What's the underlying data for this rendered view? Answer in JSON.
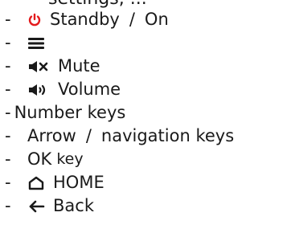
{
  "top_fragment": "settings, ...",
  "items": [
    {
      "bullet": "-",
      "icon": "power-icon",
      "label": "Standby",
      "sep": "/",
      "label2": "On"
    },
    {
      "bullet": "-",
      "icon": "menu-icon"
    },
    {
      "bullet": "-",
      "icon": "mute-icon",
      "label": "Mute"
    },
    {
      "bullet": "-",
      "icon": "volume-icon",
      "label": "Volume"
    },
    {
      "bullet": "-",
      "label": "Number keys"
    },
    {
      "bullet": "-",
      "label": "Arrow",
      "sep": "/",
      "label2": "navigation keys"
    },
    {
      "bullet": "-",
      "label": "OK",
      "label2": "key"
    },
    {
      "bullet": "-",
      "icon": "home-icon",
      "label": "HOME"
    },
    {
      "bullet": "-",
      "icon": "back-arrow-icon",
      "label": "Back"
    }
  ],
  "colors": {
    "power": "#e31a1c",
    "text": "#1a1a1a"
  }
}
